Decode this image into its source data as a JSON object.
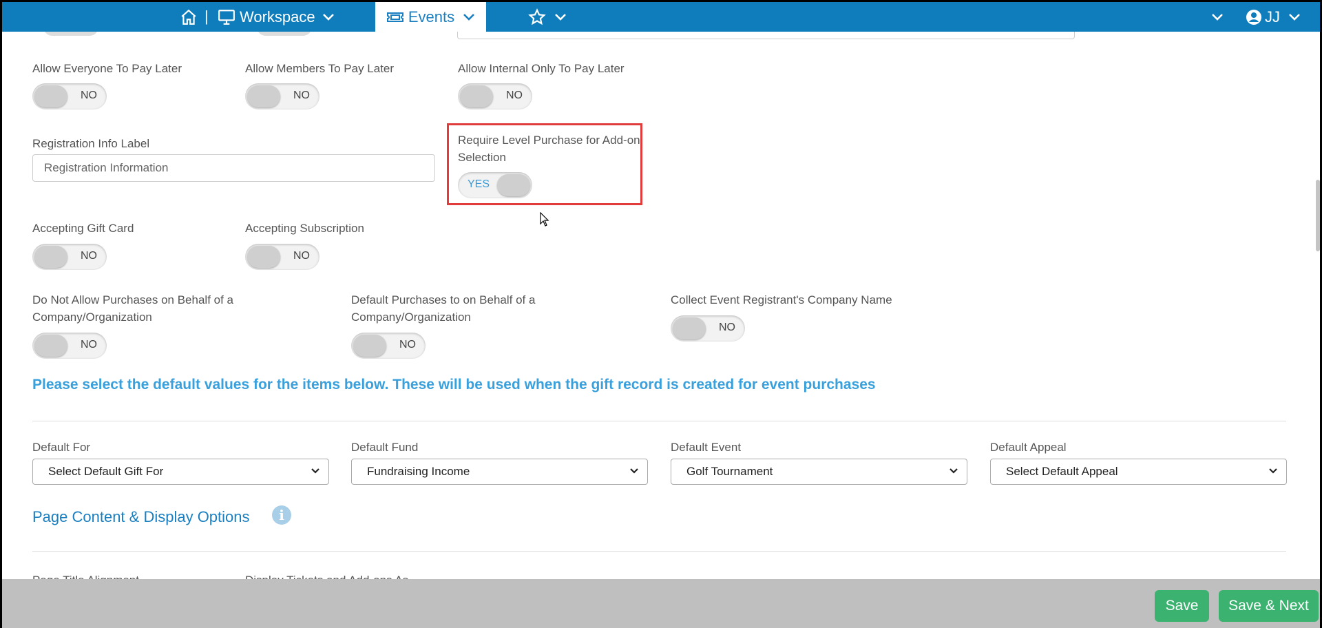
{
  "nav": {
    "workspace_label": "Workspace",
    "separator": "|",
    "events_label": "Events",
    "user_initials": "JJ",
    "icons": [
      "home-icon",
      "monitor-icon",
      "ticket-icon",
      "star-icon",
      "chevron-down-icon",
      "user-circle-icon"
    ]
  },
  "pay_later": {
    "everyone_label": "Allow Everyone To Pay Later",
    "everyone_value": "NO",
    "members_label": "Allow Members To Pay Later",
    "members_value": "NO",
    "internal_label": "Allow Internal Only To Pay Later",
    "internal_value": "NO"
  },
  "registration": {
    "label": "Registration Info Label",
    "value": "Registration Information"
  },
  "require_level": {
    "label": "Require Level Purchase for Add-on Selection",
    "value": "YES"
  },
  "gift_card": {
    "label": "Accepting Gift Card",
    "value": "NO"
  },
  "subscription": {
    "label": "Accepting Subscription",
    "value": "NO"
  },
  "behalf": {
    "not_allow_label": "Do Not Allow Purchases on Behalf of a Company/Organization",
    "not_allow_value": "NO",
    "default_label": "Default Purchases to on Behalf of a Company/Organization",
    "default_value": "NO",
    "company_name_label": "Collect Event Registrant's Company Name",
    "company_name_value": "NO"
  },
  "defaults_note": "Please select the default values for the items below. These will be used when the gift record is created for event purchases",
  "defaults": {
    "for_label": "Default For",
    "for_value": "Select Default Gift For",
    "fund_label": "Default Fund",
    "fund_value": "Fundraising Income",
    "event_label": "Default Event",
    "event_value": "Golf Tournament",
    "appeal_label": "Default Appeal",
    "appeal_value": "Select Default Appeal"
  },
  "page_content_title": "Page Content & Display Options",
  "info_glyph": "i",
  "cut_labels": {
    "alignment": "Page Title Alignment",
    "display_tickets": "Display Tickets and Add-ons As"
  },
  "footer": {
    "save_label": "Save",
    "save_next_label": "Save & Next"
  },
  "colors": {
    "nav_blue": "#0f7dbc",
    "accent_blue": "#3aa0dc",
    "save_green": "#3bb26f",
    "highlight_red": "#e03c3c"
  }
}
